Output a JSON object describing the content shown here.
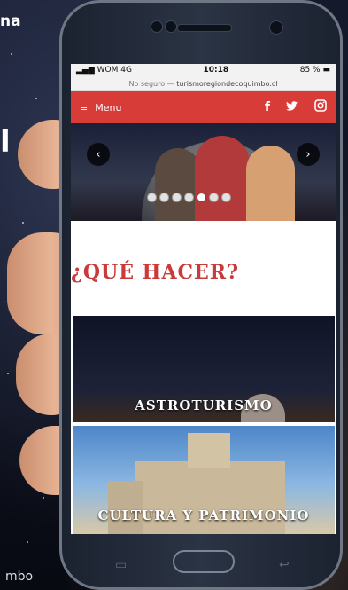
{
  "background": {
    "top_text": "na",
    "side_text": "l",
    "bottom_text": "mbo"
  },
  "status_bar": {
    "carrier": "WOM",
    "network": "4G",
    "time": "10:18",
    "battery": "85 %"
  },
  "url_bar": {
    "security": "No seguro —",
    "domain": "turismoregiondecoquimbo.cl"
  },
  "header": {
    "menu_icon": "≡",
    "menu_label": "Menu",
    "social": [
      {
        "name": "facebook-icon",
        "glyph": "f"
      },
      {
        "name": "twitter-icon",
        "glyph": "🐦"
      },
      {
        "name": "instagram-icon",
        "glyph": "◙"
      }
    ],
    "color": "#d83c38"
  },
  "slider": {
    "prev_icon": "‹",
    "next_icon": "›",
    "dots": 7,
    "active_dot": 4
  },
  "section": {
    "title": "¿QUÉ HACER?"
  },
  "cards": [
    {
      "label": "ASTROTURISMO"
    },
    {
      "label": "CULTURA Y PATRIMONIO"
    }
  ]
}
